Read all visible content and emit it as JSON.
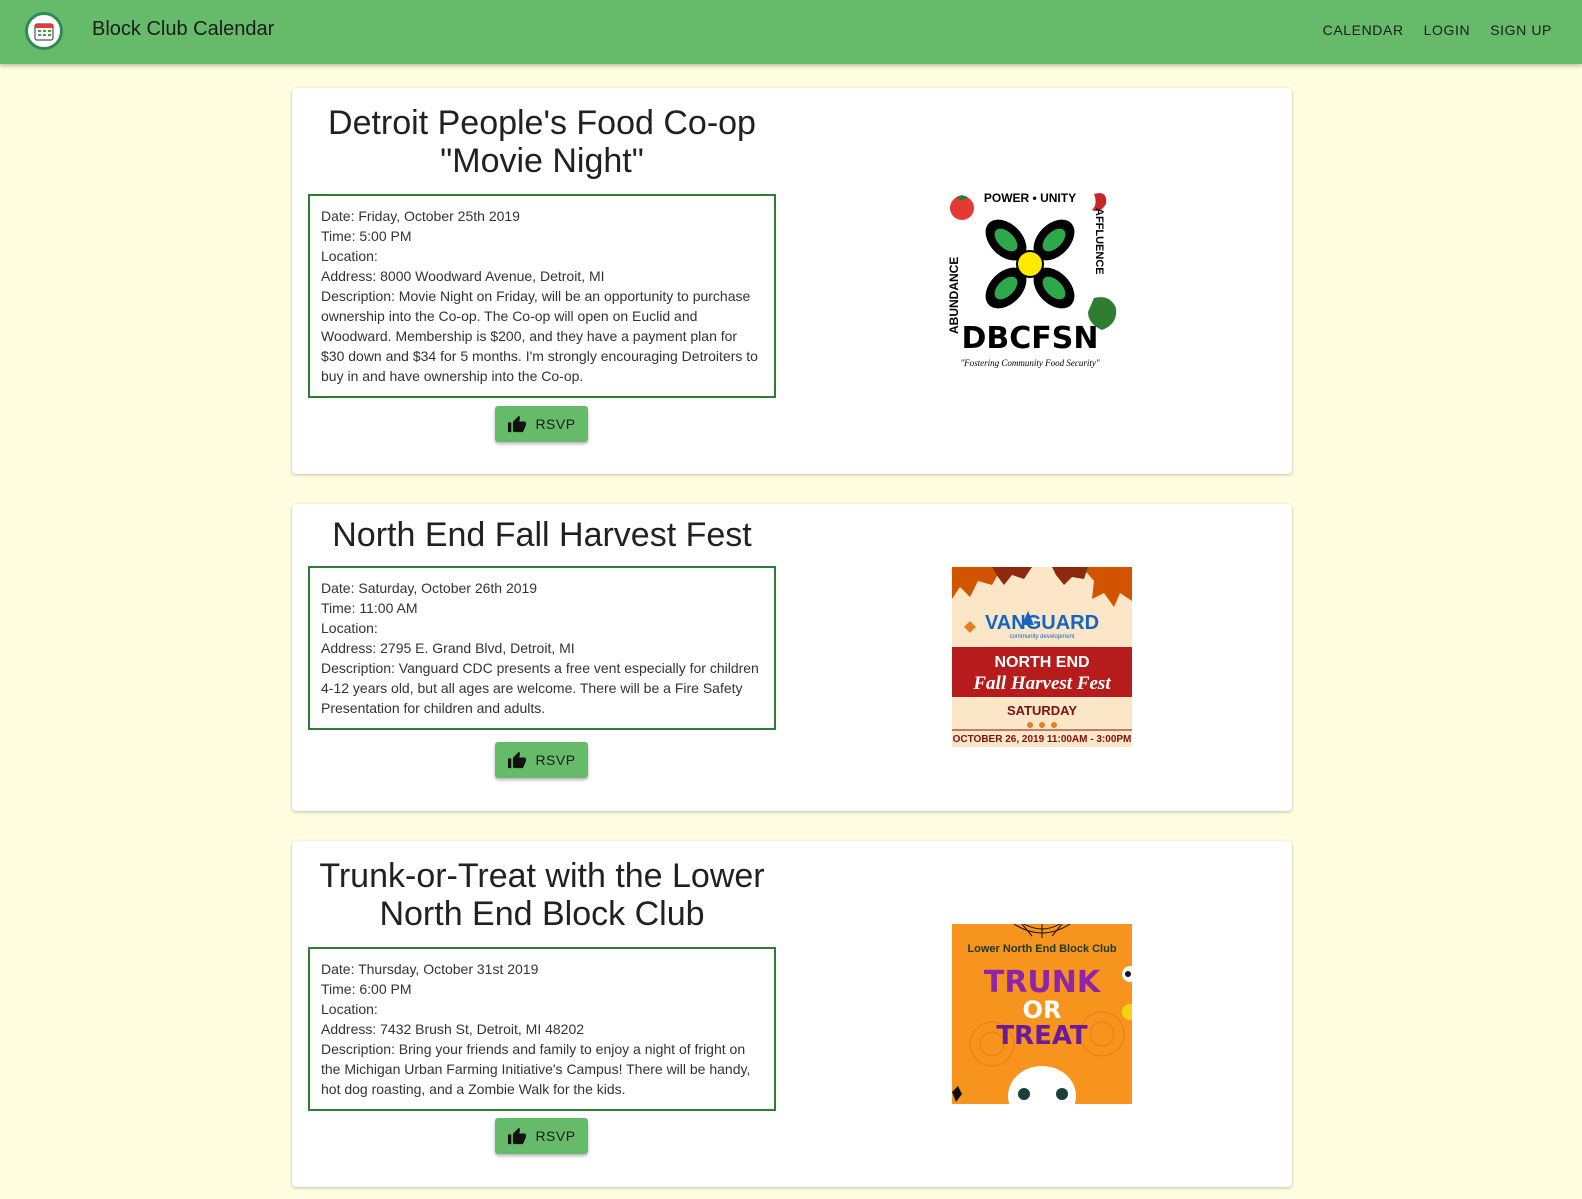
{
  "app": {
    "title": "Block Club Calendar",
    "nav": [
      "CALENDAR",
      "LOGIN",
      "SIGN UP"
    ]
  },
  "colors": {
    "appbar": "#66bb6a",
    "background": "#fffde0",
    "detail_border": "#2e7d32",
    "button": "#66bb6a"
  },
  "events": [
    {
      "title_lines": [
        "Detroit People's Food Co-op",
        "\"Movie Night\""
      ],
      "date": "Date: Friday, October 25th 2019",
      "time": "Time: 5:00 PM",
      "location": "Location:",
      "address": "Address: 8000 Woodward Avenue, Detroit, MI",
      "description": "Description: Movie Night on Friday, will be an opportunity to purchase ownership into the Co-op. The Co-op will open on Euclid and Woodward. Membership is $200, and they have a payment plan for $30 down and $34 for 5 months. I'm strongly encouraging Detroiters to buy in and have ownership into the Co-op.",
      "rsvp_label": "RSVP",
      "poster": {
        "top_text": "POWER • UNITY",
        "left_text": "ABUNDANCE",
        "right_text": "AFFLUENCE",
        "name": "DBCFSN",
        "tagline": "\"Fostering Community Food Security\""
      }
    },
    {
      "title_lines": [
        "North End Fall Harvest Fest"
      ],
      "date": "Date: Saturday, October 26th 2019",
      "time": "Time: 11:00 AM",
      "location": "Location:",
      "address": "Address: 2795 E. Grand Blvd, Detroit, MI",
      "description": "Description: Vanguard CDC presents a free vent especially for children 4-12 years old, but all ages are welcome. There will be a Fire Safety Presentation for children and adults.",
      "rsvp_label": "RSVP",
      "poster": {
        "brand": "VANGUARD",
        "brand_sub": "community development",
        "line1": "NORTH END",
        "line2": "Fall Harvest Fest",
        "line3": "SATURDAY",
        "line4": "OCTOBER 26, 2019 11:00AM - 3:00PM"
      }
    },
    {
      "title_lines": [
        "Trunk-or-Treat with the Lower",
        "North End Block Club"
      ],
      "date": "Date: Thursday, October 31st 2019",
      "time": "Time: 6:00 PM",
      "location": "Location:",
      "address": "Address: 7432 Brush St, Detroit, MI 48202",
      "description": "Description: Bring your friends and family to enjoy a night of fright on the Michigan Urban Farming Initiative's Campus! There will be handy, hot dog roasting, and a Zombie Walk for the kids.",
      "rsvp_label": "RSVP",
      "poster": {
        "header": "Lower North End Block Club",
        "line1": "TRUNK",
        "line2": "OR",
        "line3": "TREAT"
      }
    }
  ]
}
